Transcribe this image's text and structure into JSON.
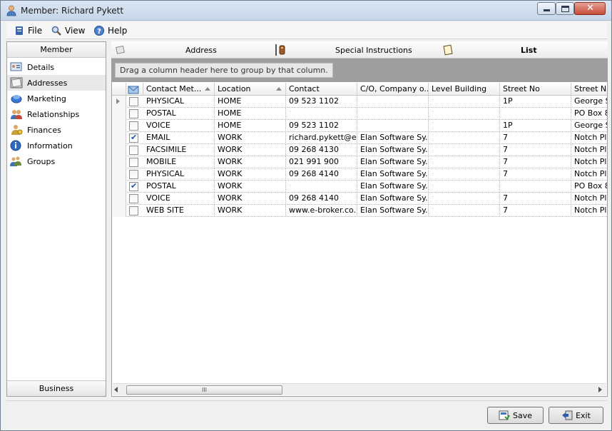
{
  "window": {
    "title": "Member: Richard Pykett"
  },
  "menu": [
    {
      "label": "File",
      "icon": "file-icon"
    },
    {
      "label": "View",
      "icon": "view-icon"
    },
    {
      "label": "Help",
      "icon": "help-icon"
    }
  ],
  "nav": {
    "header": "Member",
    "footer": "Business",
    "items": [
      {
        "label": "Details",
        "icon": "details-icon",
        "selected": false
      },
      {
        "label": "Addresses",
        "icon": "addresses-icon",
        "selected": true
      },
      {
        "label": "Marketing",
        "icon": "marketing-icon",
        "selected": false
      },
      {
        "label": "Relationships",
        "icon": "relationships-icon",
        "selected": false
      },
      {
        "label": "Finances",
        "icon": "finances-icon",
        "selected": false
      },
      {
        "label": "Information",
        "icon": "information-icon",
        "selected": false
      },
      {
        "label": "Groups",
        "icon": "groups-icon",
        "selected": false
      }
    ]
  },
  "tabs": [
    {
      "label": "Address",
      "icon": "address-book-icon",
      "active": false
    },
    {
      "label": "Special Instructions",
      "icon": "instructions-icon",
      "active": false
    },
    {
      "label": "List",
      "icon": "list-icon",
      "active": true
    }
  ],
  "grid": {
    "group_hint": "Drag a column header here to group by that column.",
    "columns": [
      "Contact Met...",
      "Location",
      "Contact",
      "C/O, Company o...",
      "Level Building",
      "Street No",
      "Street Na"
    ],
    "rows": [
      {
        "checked": false,
        "current": true,
        "cells": [
          "PHYSICAL",
          "HOME",
          "09 523 1102",
          "",
          "",
          "1P",
          "George S"
        ]
      },
      {
        "checked": false,
        "current": false,
        "cells": [
          "POSTAL",
          "HOME",
          "",
          "",
          "",
          "",
          "PO Box 8"
        ]
      },
      {
        "checked": false,
        "current": false,
        "cells": [
          "VOICE",
          "HOME",
          "09 523 1102",
          "",
          "",
          "1P",
          "George S"
        ]
      },
      {
        "checked": true,
        "current": false,
        "cells": [
          "EMAIL",
          "WORK",
          "richard.pykett@e...",
          "Elan Software Sy...",
          "",
          "7",
          "Notch Pla"
        ]
      },
      {
        "checked": false,
        "current": false,
        "cells": [
          "FACSIMILE",
          "WORK",
          "09 268 4130",
          "Elan Software Sy...",
          "",
          "7",
          "Notch Pla"
        ]
      },
      {
        "checked": false,
        "current": false,
        "cells": [
          "MOBILE",
          "WORK",
          "021 991 900",
          "Elan Software Sy...",
          "",
          "7",
          "Notch Pla"
        ]
      },
      {
        "checked": false,
        "current": false,
        "cells": [
          "PHYSICAL",
          "WORK",
          "09 268 4140",
          "Elan Software Sy...",
          "",
          "7",
          "Notch Pla"
        ]
      },
      {
        "checked": true,
        "current": false,
        "cells": [
          "POSTAL",
          "WORK",
          "",
          "Elan Software Sy...",
          "",
          "",
          "PO Box 8"
        ]
      },
      {
        "checked": false,
        "current": false,
        "cells": [
          "VOICE",
          "WORK",
          "09 268 4140",
          "Elan Software Sy...",
          "",
          "7",
          "Notch Pla"
        ]
      },
      {
        "checked": false,
        "current": false,
        "cells": [
          "WEB SITE",
          "WORK",
          "www.e-broker.co...",
          "Elan Software Sy...",
          "",
          "7",
          "Notch Pla"
        ]
      }
    ],
    "scroll_thumb": "III"
  },
  "buttons": {
    "save": "Save",
    "exit": "Exit"
  }
}
